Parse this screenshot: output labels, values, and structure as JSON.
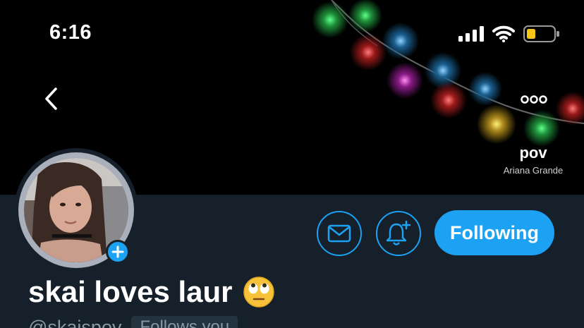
{
  "status_bar": {
    "time": "6:16"
  },
  "banner": {
    "now_playing": {
      "title": "pov",
      "artist": "Ariana Grande"
    }
  },
  "nav": {
    "back_icon": "chevron-left-icon",
    "more_icon": "more-horizontal-icon"
  },
  "profile": {
    "display_name": "skai loves laur",
    "emoji": "🙄",
    "handle": "@skaispov",
    "follows_you": "Follows you",
    "actions": {
      "message_icon": "envelope-icon",
      "notify_icon": "bell-plus-icon",
      "follow_label": "Following"
    }
  },
  "colors": {
    "accent": "#1da1f2",
    "profile_bg": "#15202b",
    "banner_bg": "#000000",
    "secondary_text": "#8899a6",
    "battery": "#f5c518"
  }
}
